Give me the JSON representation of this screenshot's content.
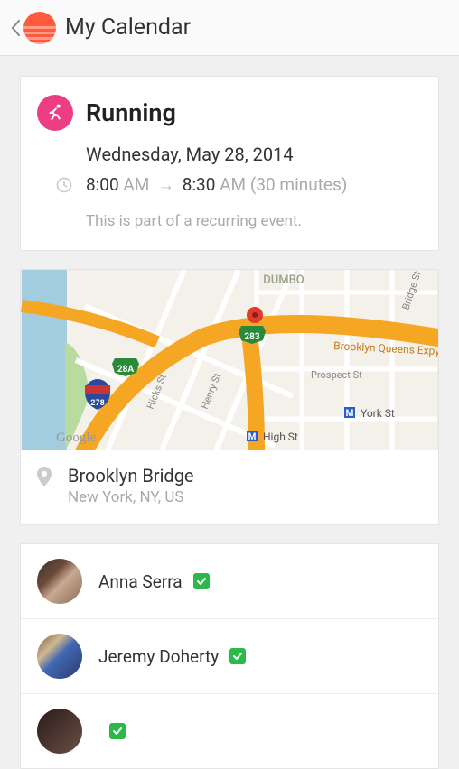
{
  "header": {
    "title": "My Calendar"
  },
  "event": {
    "title": "Running",
    "date": "Wednesday, May 28, 2014",
    "start_time": "8:00",
    "start_ampm": "AM",
    "end_time": "8:30",
    "end_ampm": "AM",
    "duration": "(30 minutes)",
    "recurring_text": "This is part of a recurring event."
  },
  "map": {
    "labels": {
      "dumbo": "DUMBO",
      "bqe": "Brooklyn Queens Expy",
      "prospect": "Prospect St",
      "york": "York St",
      "high": "High St",
      "bridge": "Bridge St",
      "hicks": "Hicks St",
      "henry": "Henry St",
      "attribution": "Google",
      "shield_28a": "28A",
      "shield_283": "283",
      "shield_278": "278"
    }
  },
  "location": {
    "name": "Brooklyn Bridge",
    "sub": "New York, NY, US"
  },
  "attendees": [
    {
      "name": "Anna Serra",
      "confirmed": true
    },
    {
      "name": "Jeremy Doherty",
      "confirmed": true
    }
  ]
}
